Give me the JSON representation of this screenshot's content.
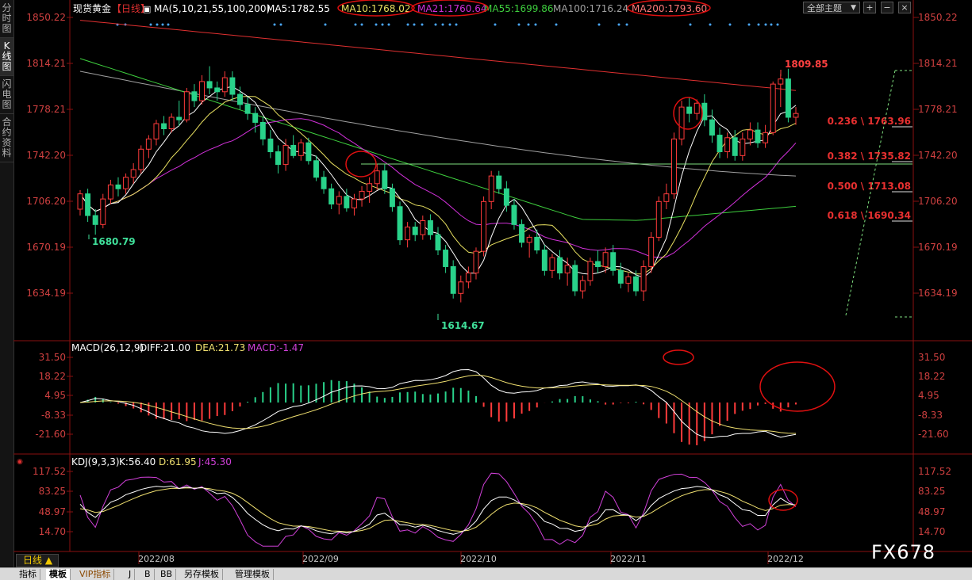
{
  "sidebar": {
    "tabs": [
      {
        "label": "分时图",
        "active": false
      },
      {
        "label": "K线图",
        "active": true
      },
      {
        "label": "闪电图",
        "active": false
      },
      {
        "label": "合约资料",
        "active": false
      }
    ]
  },
  "header": {
    "title": "现货黄金",
    "period_tag": "【日线】",
    "ma_label": "MA(5,10,21,55,100,200)",
    "ma5": "MA5:1782.55",
    "ma10": "MA10:1768.02",
    "ma21": "MA21:1760.64",
    "ma55": "MA55:1699.86",
    "ma100": "MA100:1716.24",
    "ma200": "MA200:1793.60",
    "theme_select": "全部主题",
    "btn_add": "+",
    "btn_minus": "−",
    "btn_close": "×"
  },
  "colors": {
    "up": "#ff3b3b",
    "down": "#29d28a",
    "ma5": "#ffffff",
    "ma10": "#e8e060",
    "ma21": "#d030d8",
    "ma55": "#3ecf3e",
    "ma100": "#a0a0a0",
    "ma200": "#e03030",
    "axis_text_price": "#e84848",
    "grid": "#2a2a2a",
    "annot_circle": "#e01010",
    "fib_text": "#e83030"
  },
  "price_axis": {
    "ticks": [
      "1850.22",
      "1814.21",
      "1778.21",
      "1742.20",
      "1706.20",
      "1670.19",
      "1634.19"
    ]
  },
  "annotations": {
    "high_label": "1809.85",
    "low1_label": "1680.79",
    "low2_label": "1614.67",
    "fib": [
      {
        "label": "0.236 \\ 1763.96"
      },
      {
        "label": "0.382 \\ 1735.82"
      },
      {
        "label": "0.500 \\ 1713.08"
      },
      {
        "label": "0.618 \\ 1690.34"
      }
    ]
  },
  "macd": {
    "title": "MACD(26,12,9)",
    "diff": "DIFF:21.00",
    "dea": "DEA:21.73",
    "macd": "MACD:-1.47",
    "ticks": [
      "31.50",
      "18.22",
      "4.95",
      "-8.33",
      "-21.60"
    ]
  },
  "kdj": {
    "title": "KDJ(9,3,3)",
    "k": "K:56.40",
    "d": "D:61.95",
    "j": "J:45.30",
    "ticks": [
      "117.52",
      "83.25",
      "48.97",
      "14.70"
    ]
  },
  "x_axis": {
    "labels": [
      "2022/08",
      "2022/09",
      "2022/10",
      "2022/11",
      "2022/12"
    ]
  },
  "footer": {
    "period_label": "日线 ▲",
    "tabs": [
      {
        "label": "指标",
        "active": false
      },
      {
        "label": "模板",
        "active": true
      },
      {
        "label": "VIP指标",
        "active": false
      },
      {
        "label": "J",
        "active": false
      },
      {
        "label": "B",
        "active": false
      },
      {
        "label": "BB",
        "active": false
      },
      {
        "label": "另存模板",
        "active": false
      },
      {
        "label": "管理模板",
        "active": false
      }
    ]
  },
  "watermark": "FX678",
  "chart_data": {
    "type": "candlestick",
    "instrument": "现货黄金",
    "timeframe": "日线",
    "x": [
      "2022/08",
      "2022/09",
      "2022/10",
      "2022/11",
      "2022/12"
    ],
    "ylim": [
      1614,
      1855
    ],
    "candles": [
      [
        1700,
        1715,
        1695,
        1712
      ],
      [
        1712,
        1716,
        1690,
        1695
      ],
      [
        1695,
        1700,
        1680,
        1688
      ],
      [
        1688,
        1712,
        1685,
        1708
      ],
      [
        1708,
        1723,
        1704,
        1719
      ],
      [
        1719,
        1725,
        1710,
        1716
      ],
      [
        1716,
        1728,
        1712,
        1725
      ],
      [
        1725,
        1736,
        1720,
        1731
      ],
      [
        1731,
        1750,
        1728,
        1747
      ],
      [
        1747,
        1758,
        1740,
        1755
      ],
      [
        1755,
        1770,
        1750,
        1767
      ],
      [
        1767,
        1773,
        1758,
        1763
      ],
      [
        1763,
        1775,
        1760,
        1772
      ],
      [
        1772,
        1785,
        1765,
        1770
      ],
      [
        1770,
        1795,
        1768,
        1792
      ],
      [
        1792,
        1798,
        1780,
        1785
      ],
      [
        1785,
        1805,
        1782,
        1800
      ],
      [
        1800,
        1812,
        1790,
        1795
      ],
      [
        1795,
        1800,
        1785,
        1792
      ],
      [
        1792,
        1808,
        1788,
        1803
      ],
      [
        1803,
        1808,
        1785,
        1790
      ],
      [
        1790,
        1796,
        1778,
        1782
      ],
      [
        1782,
        1788,
        1770,
        1775
      ],
      [
        1775,
        1780,
        1760,
        1768
      ],
      [
        1768,
        1772,
        1750,
        1755
      ],
      [
        1755,
        1762,
        1740,
        1745
      ],
      [
        1745,
        1750,
        1728,
        1735
      ],
      [
        1735,
        1755,
        1730,
        1750
      ],
      [
        1750,
        1758,
        1740,
        1742
      ],
      [
        1742,
        1755,
        1738,
        1752
      ],
      [
        1752,
        1756,
        1735,
        1738
      ],
      [
        1738,
        1742,
        1722,
        1725
      ],
      [
        1725,
        1730,
        1712,
        1716
      ],
      [
        1716,
        1720,
        1700,
        1704
      ],
      [
        1704,
        1714,
        1696,
        1710
      ],
      [
        1710,
        1716,
        1698,
        1701
      ],
      [
        1701,
        1712,
        1695,
        1708
      ],
      [
        1708,
        1718,
        1702,
        1714
      ],
      [
        1714,
        1725,
        1705,
        1720
      ],
      [
        1720,
        1735,
        1715,
        1730
      ],
      [
        1730,
        1735,
        1712,
        1716
      ],
      [
        1716,
        1720,
        1698,
        1702
      ],
      [
        1702,
        1706,
        1672,
        1676
      ],
      [
        1676,
        1690,
        1670,
        1686
      ],
      [
        1686,
        1690,
        1675,
        1680
      ],
      [
        1680,
        1695,
        1676,
        1691
      ],
      [
        1691,
        1696,
        1676,
        1680
      ],
      [
        1680,
        1686,
        1664,
        1668
      ],
      [
        1668,
        1672,
        1650,
        1655
      ],
      [
        1655,
        1660,
        1630,
        1634
      ],
      [
        1634,
        1648,
        1627,
        1643
      ],
      [
        1643,
        1655,
        1638,
        1650
      ],
      [
        1650,
        1670,
        1645,
        1667
      ],
      [
        1667,
        1710,
        1663,
        1706
      ],
      [
        1706,
        1730,
        1700,
        1726
      ],
      [
        1726,
        1730,
        1712,
        1716
      ],
      [
        1716,
        1722,
        1698,
        1703
      ],
      [
        1703,
        1708,
        1684,
        1688
      ],
      [
        1688,
        1692,
        1670,
        1674
      ],
      [
        1674,
        1680,
        1662,
        1678
      ],
      [
        1678,
        1684,
        1665,
        1668
      ],
      [
        1668,
        1672,
        1648,
        1652
      ],
      [
        1652,
        1665,
        1646,
        1662
      ],
      [
        1662,
        1668,
        1645,
        1650
      ],
      [
        1650,
        1662,
        1640,
        1656
      ],
      [
        1656,
        1660,
        1632,
        1636
      ],
      [
        1636,
        1648,
        1630,
        1644
      ],
      [
        1644,
        1662,
        1640,
        1659
      ],
      [
        1659,
        1668,
        1650,
        1655
      ],
      [
        1655,
        1670,
        1650,
        1666
      ],
      [
        1666,
        1672,
        1648,
        1652
      ],
      [
        1652,
        1658,
        1638,
        1642
      ],
      [
        1642,
        1650,
        1635,
        1647
      ],
      [
        1647,
        1652,
        1632,
        1636
      ],
      [
        1636,
        1660,
        1628,
        1655
      ],
      [
        1655,
        1682,
        1650,
        1678
      ],
      [
        1678,
        1710,
        1675,
        1706
      ],
      [
        1706,
        1720,
        1700,
        1712
      ],
      [
        1712,
        1760,
        1708,
        1755
      ],
      [
        1755,
        1785,
        1750,
        1780
      ],
      [
        1780,
        1788,
        1768,
        1775
      ],
      [
        1775,
        1786,
        1770,
        1783
      ],
      [
        1783,
        1790,
        1765,
        1770
      ],
      [
        1770,
        1778,
        1752,
        1758
      ],
      [
        1758,
        1764,
        1740,
        1745
      ],
      [
        1745,
        1760,
        1740,
        1756
      ],
      [
        1756,
        1762,
        1738,
        1742
      ],
      [
        1742,
        1760,
        1738,
        1755
      ],
      [
        1755,
        1768,
        1750,
        1762
      ],
      [
        1762,
        1768,
        1748,
        1752
      ],
      [
        1752,
        1766,
        1748,
        1760
      ],
      [
        1760,
        1800,
        1758,
        1798
      ],
      [
        1798,
        1806,
        1780,
        1802
      ],
      [
        1802,
        1810,
        1768,
        1772
      ],
      [
        1772,
        1780,
        1766,
        1775
      ]
    ]
  }
}
